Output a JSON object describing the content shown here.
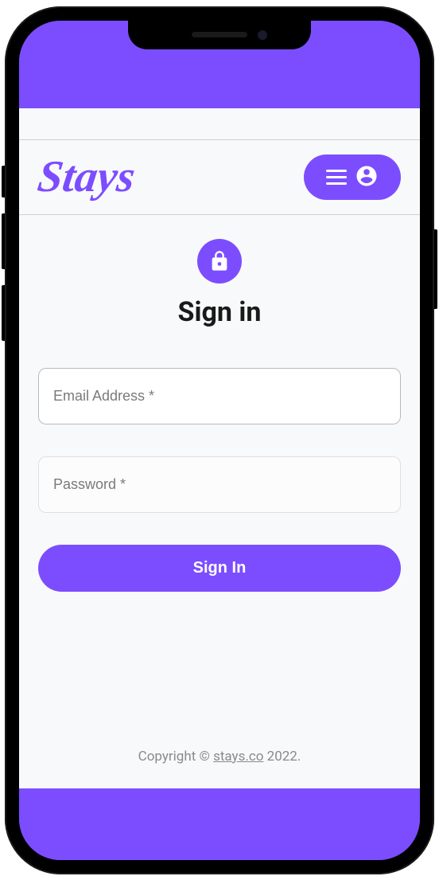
{
  "brand": {
    "logo_text": "Stays",
    "accent_color": "#7c4dff"
  },
  "header": {
    "menu_aria": "menu"
  },
  "signin": {
    "title": "Sign in",
    "email_placeholder": "Email Address *",
    "password_placeholder": "Password *",
    "submit_label": "Sign In"
  },
  "footer": {
    "copyright_prefix": "Copyright © ",
    "site_link_text": "stays.co",
    "copyright_suffix": " 2022."
  }
}
